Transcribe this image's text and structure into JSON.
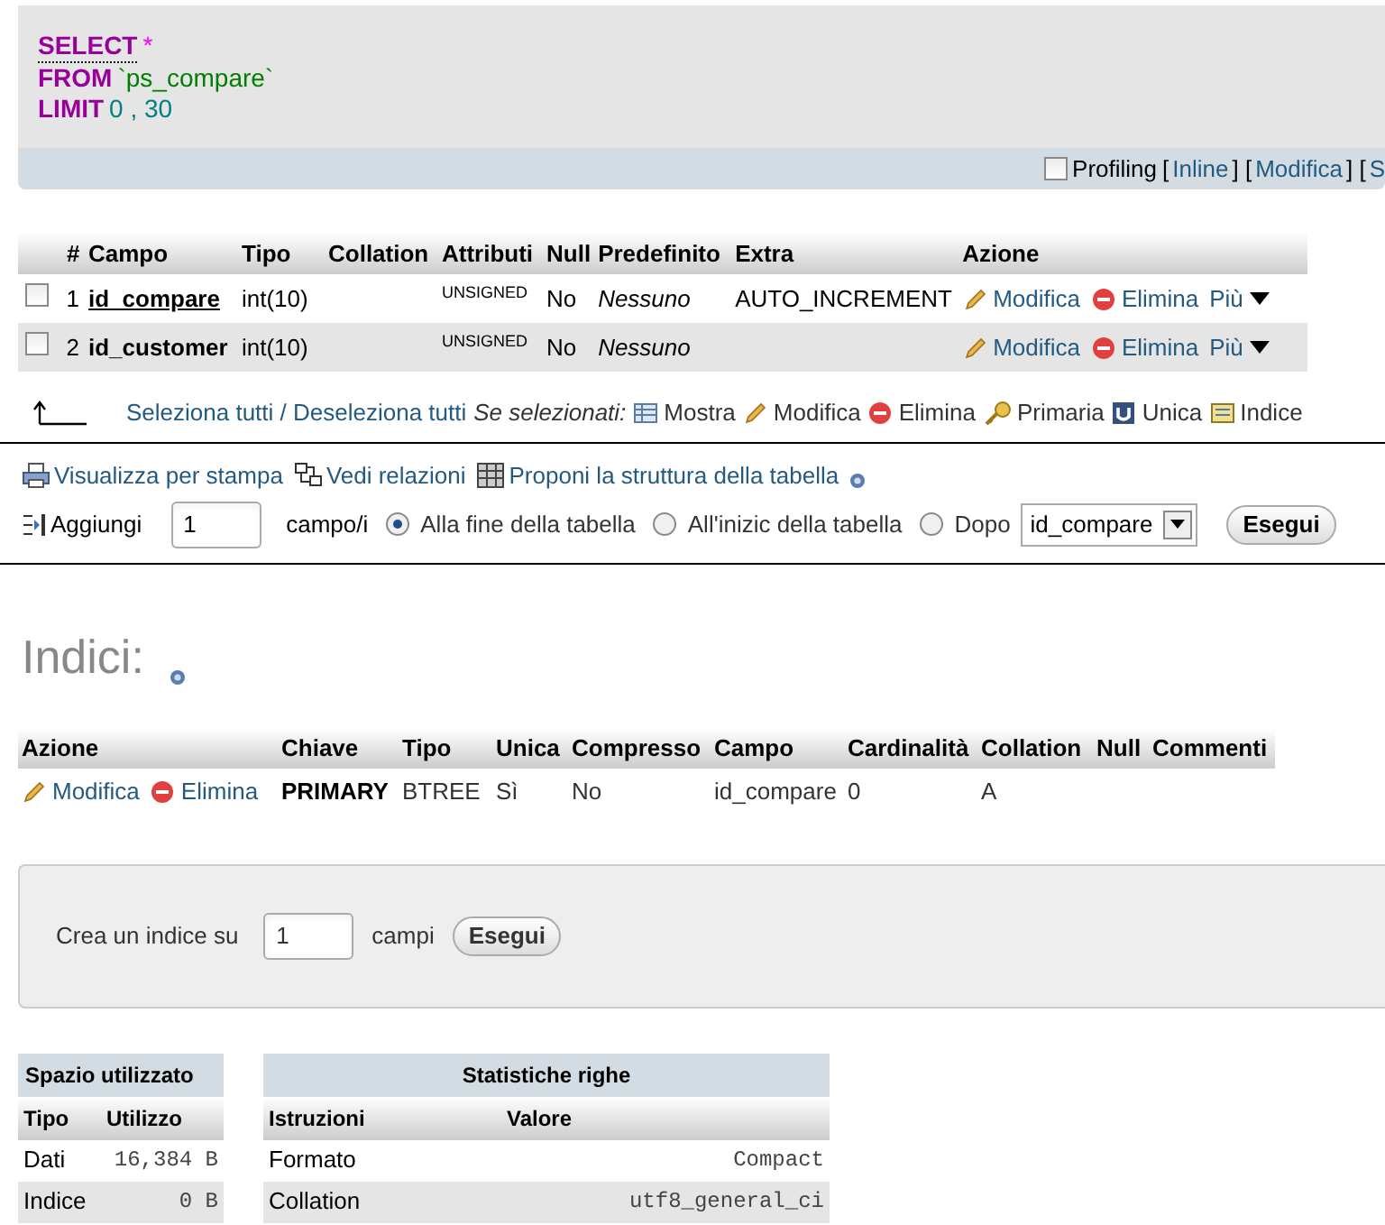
{
  "sql_query": {
    "lines": [
      {
        "keyword": "SELECT",
        "rest": "*",
        "kind": "operator"
      },
      {
        "keyword": "FROM",
        "rest": "`ps_compare`",
        "kind": "string"
      },
      {
        "keyword": "LIMIT",
        "rest": "0 , 30",
        "kind": "number"
      }
    ],
    "toolbar": {
      "profiling": {
        "label": "Profiling",
        "checked": false
      },
      "links": [
        "[",
        "Inline",
        "] [",
        "Modifica",
        "] [",
        "S"
      ]
    }
  },
  "structure": {
    "columns": [
      "",
      "#",
      "Campo",
      "Tipo",
      "Collation",
      "Attributi",
      "Null",
      "Predefinito",
      "Extra",
      "Azione"
    ],
    "rows": [
      {
        "checked": false,
        "num": "1",
        "field": "id_compare",
        "primary": true,
        "type": "int(10)",
        "collation": "",
        "attributes": "UNSIGNED",
        "null": "No",
        "default": "Nessuno",
        "extra": "AUTO_INCREMENT",
        "actions": [
          "Modifica",
          "Elimina",
          "Più"
        ]
      },
      {
        "checked": false,
        "num": "2",
        "field": "id_customer",
        "primary": false,
        "type": "int(10)",
        "collation": "",
        "attributes": "UNSIGNED",
        "null": "No",
        "default": "Nessuno",
        "extra": "",
        "actions": [
          "Modifica",
          "Elimina",
          "Più"
        ]
      }
    ],
    "bulk": {
      "select_all": "Seleziona tutti / Deseleziona tutti",
      "with_selected": "Se selezionati:",
      "actions": [
        {
          "kind": "browse",
          "label": "Mostra"
        },
        {
          "kind": "edit",
          "label": "Modifica"
        },
        {
          "kind": "drop",
          "label": "Elimina"
        },
        {
          "kind": "primary",
          "label": "Primaria"
        },
        {
          "kind": "unique",
          "label": "Unica"
        },
        {
          "kind": "index",
          "label": "Indice"
        }
      ]
    }
  },
  "links": [
    {
      "kind": "print",
      "label": "Visualizza per stampa"
    },
    {
      "kind": "relations",
      "label": "Vedi relazioni"
    },
    {
      "kind": "propose",
      "label": "Proponi la struttura della tabella"
    }
  ],
  "add_fields": {
    "label": "Aggiungi",
    "count": "1",
    "unit": "campo/i",
    "positions": [
      {
        "label": "Alla fine della tabella",
        "selected": true
      },
      {
        "label": "All'inizic della tabella",
        "selected": false
      },
      {
        "label": "Dopo",
        "selected": false
      }
    ],
    "after_field": "id_compare",
    "submit": "Esegui"
  },
  "indexes": {
    "title": "Indici:",
    "columns": [
      "Azione",
      "Chiave",
      "Tipo",
      "Unica",
      "Compresso",
      "Campo",
      "Cardinalità",
      "Collation",
      "Null",
      "Commenti"
    ],
    "rows": [
      {
        "actions": [
          "Modifica",
          "Elimina"
        ],
        "key": "PRIMARY",
        "type": "BTREE",
        "unique": "Sì",
        "packed": "No",
        "field": "id_compare",
        "cardinality": "0",
        "collation": "A",
        "null": "",
        "comment": ""
      }
    ]
  },
  "create_index": {
    "label": "Crea un indice su",
    "count": "1",
    "unit": "campi",
    "submit": "Esegui"
  },
  "space_usage": {
    "title": "Spazio utilizzato",
    "columns": [
      "Tipo",
      "Utilizzo"
    ],
    "rows": [
      [
        "Dati",
        "16,384 B"
      ],
      [
        "Indice",
        "0 B"
      ]
    ]
  },
  "row_stats": {
    "title": "Statistiche righe",
    "columns": [
      "Istruzioni",
      "Valore"
    ],
    "rows": [
      [
        "Formato",
        "Compact"
      ],
      [
        "Collation",
        "utf8_general_ci"
      ]
    ]
  }
}
